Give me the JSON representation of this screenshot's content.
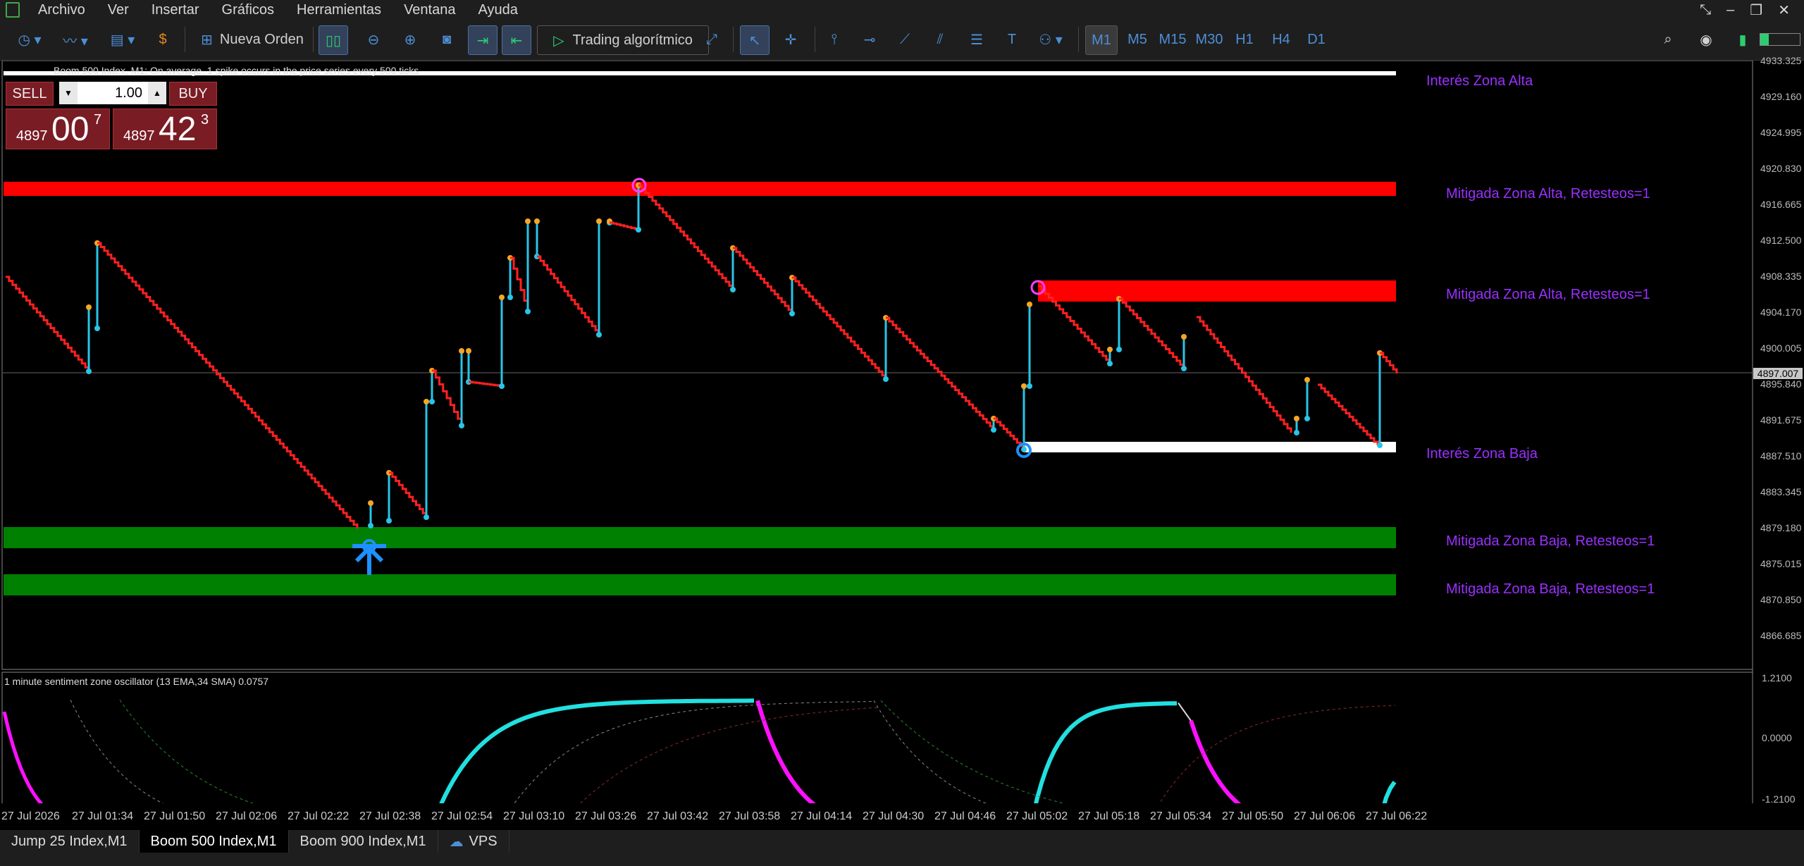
{
  "menu": [
    "Archivo",
    "Ver",
    "Insertar",
    "Gráficos",
    "Herramientas",
    "Ventana",
    "Ayuda"
  ],
  "toolbar": {
    "new_order": "Nueva Orden",
    "algo_trading": "Trading algorítmico",
    "timeframes": [
      "M1",
      "M5",
      "M15",
      "M30",
      "H1",
      "H4",
      "D1"
    ],
    "active_timeframe": "M1"
  },
  "chart": {
    "symbol_line": "Boom 500 Index, M1:  On average, 1 spike occurs in the price series every 500 ticks",
    "trade_panel": {
      "sell_label": "SELL",
      "buy_label": "BUY",
      "lot": "1.00",
      "sell_small": "4897",
      "sell_big": "00",
      "sell_sup": "7",
      "buy_small": "4897",
      "buy_big": "42",
      "buy_sup": "3"
    },
    "zone_labels": {
      "interes_alta": "Interés Zona Alta",
      "mitigada_alta_1": "Mitigada Zona Alta, Retesteos=1",
      "mitigada_alta_2": "Mitigada Zona Alta, Retesteos=1",
      "interes_baja": "Interés Zona Baja",
      "mitigada_baja_1": "Mitigada Zona Baja, Retesteos=1",
      "mitigada_baja_2": "Mitigada Zona Baja, Retesteos=1"
    },
    "price_ticks": [
      "4933.325",
      "4929.160",
      "4924.995",
      "4920.830",
      "4916.665",
      "4912.500",
      "4908.335",
      "4904.170",
      "4900.005",
      "4895.840",
      "4891.675",
      "4887.510",
      "4883.345",
      "4879.180",
      "4875.015",
      "4870.850",
      "4866.685"
    ],
    "current_price": "4897.007",
    "oscillator": {
      "title": "1 minute sentiment zone oscillator (13 EMA,34 SMA) 0.0757",
      "ticks": [
        "1.2100",
        "0.0000",
        "-1.2100"
      ]
    },
    "time_ticks": [
      "27 Jul 2026",
      "27 Jul 01:34",
      "27 Jul 01:50",
      "27 Jul 02:06",
      "27 Jul 02:22",
      "27 Jul 02:38",
      "27 Jul 02:54",
      "27 Jul 03:10",
      "27 Jul 03:26",
      "27 Jul 03:42",
      "27 Jul 03:58",
      "27 Jul 04:14",
      "27 Jul 04:30",
      "27 Jul 04:46",
      "27 Jul 05:02",
      "27 Jul 05:18",
      "27 Jul 05:34",
      "27 Jul 05:50",
      "27 Jul 06:06",
      "27 Jul 06:22"
    ],
    "colors": {
      "supply_zone": "#ff0000",
      "demand_zone": "#008000",
      "interest_zone": "#ffffff",
      "spike_candle": "#29c5e6",
      "down_candle": "#ff2020",
      "osc_up": "#22e0e0",
      "osc_down": "#ff10ff",
      "label": "#9b30ff"
    }
  },
  "tabs": [
    "Jump 25 Index,M1",
    "Boom 500 Index,M1",
    "Boom 900 Index,M1",
    "VPS"
  ],
  "active_tab": "Boom 500 Index,M1"
}
